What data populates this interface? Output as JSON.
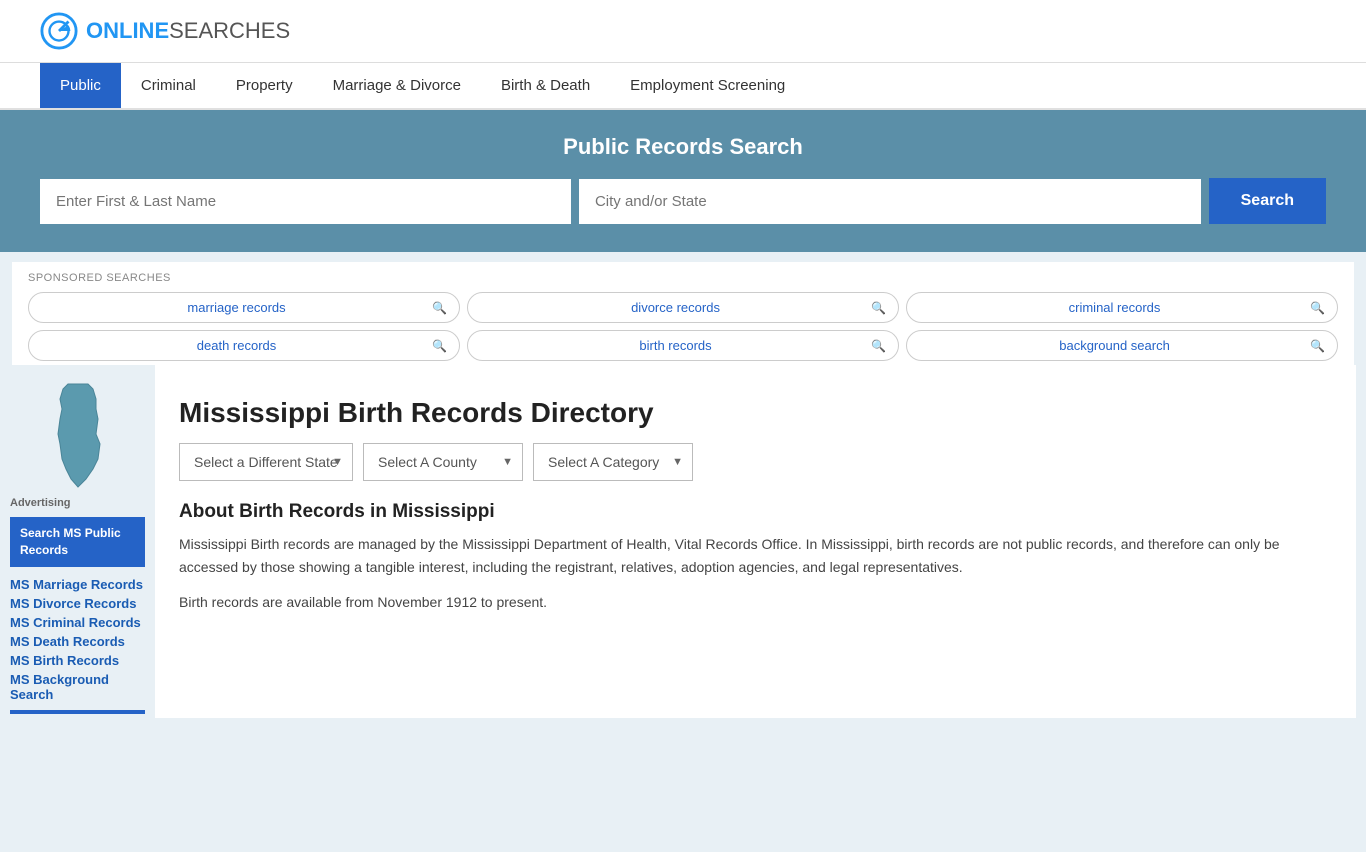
{
  "header": {
    "logo_online": "ONLINE",
    "logo_searches": "SEARCHES",
    "logo_alt": "OnlineSearches Logo"
  },
  "nav": {
    "items": [
      {
        "label": "Public",
        "active": true
      },
      {
        "label": "Criminal",
        "active": false
      },
      {
        "label": "Property",
        "active": false
      },
      {
        "label": "Marriage & Divorce",
        "active": false
      },
      {
        "label": "Birth & Death",
        "active": false
      },
      {
        "label": "Employment Screening",
        "active": false
      }
    ]
  },
  "search_banner": {
    "title": "Public Records Search",
    "name_placeholder": "Enter First & Last Name",
    "location_placeholder": "City and/or State",
    "button_label": "Search"
  },
  "sponsored": {
    "label": "SPONSORED SEARCHES",
    "pills": [
      {
        "text": "marriage records",
        "row": 1
      },
      {
        "text": "divorce records",
        "row": 1
      },
      {
        "text": "criminal records",
        "row": 1
      },
      {
        "text": "death records",
        "row": 2
      },
      {
        "text": "birth records",
        "row": 2
      },
      {
        "text": "background search",
        "row": 2
      }
    ]
  },
  "directory": {
    "title": "Mississippi Birth Records Directory",
    "dropdowns": [
      {
        "label": "Select a Different State",
        "placeholder": "Select a Different State"
      },
      {
        "label": "Select A County",
        "placeholder": "Select A County"
      },
      {
        "label": "Select A Category",
        "placeholder": "Select A Category"
      }
    ]
  },
  "about": {
    "title": "About Birth Records in Mississippi",
    "paragraphs": [
      "Mississippi Birth records are managed by the Mississippi Department of Health, Vital Records Office. In Mississippi, birth records are not public records, and therefore can only be accessed by those showing a tangible interest, including the registrant, relatives, adoption agencies, and legal representatives.",
      "Birth records are available from November 1912 to present."
    ]
  },
  "sidebar": {
    "advertising_label": "Advertising",
    "ad_button": "Search MS Public Records",
    "links": [
      {
        "text": "MS Marriage Records"
      },
      {
        "text": "MS Divorce Records"
      },
      {
        "text": "MS Criminal Records"
      },
      {
        "text": "MS Death Records"
      },
      {
        "text": "MS Birth Records"
      },
      {
        "text": "MS Background Search"
      }
    ]
  },
  "colors": {
    "nav_active_bg": "#2563c7",
    "banner_bg": "#5b8fa8",
    "search_btn": "#2563c7",
    "link_color": "#1a5cb3",
    "ms_shape": "#5b9aae"
  }
}
